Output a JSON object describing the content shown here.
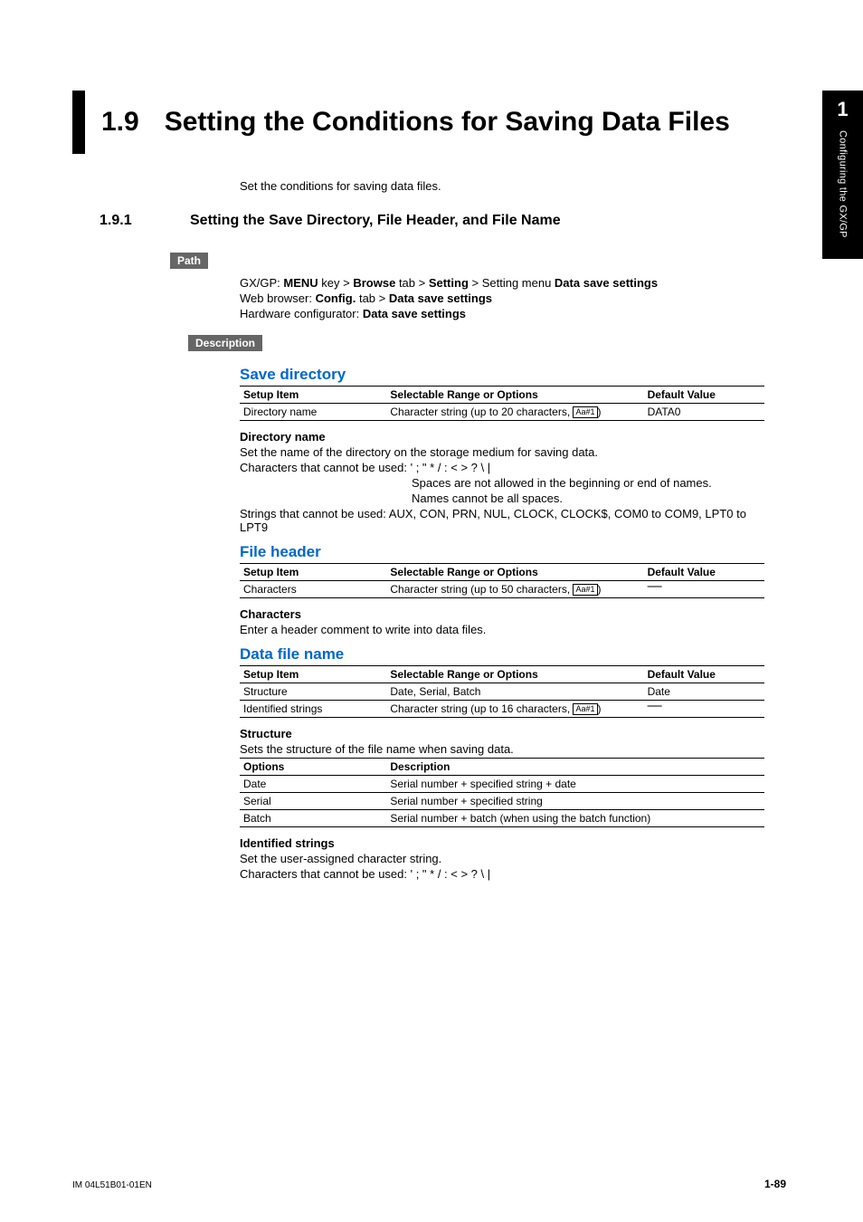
{
  "tab": {
    "num": "1",
    "text": "Configuring the GX/GP"
  },
  "title": {
    "num": "1.9",
    "text": "Setting the Conditions for Saving Data Files"
  },
  "intro": "Set the conditions for saving data files.",
  "sub": {
    "num": "1.9.1",
    "text": "Setting the Save Directory, File Header, and File Name"
  },
  "tags": {
    "path": "Path",
    "description": "Description"
  },
  "path": {
    "l1a": "GX/GP: ",
    "l1b": "MENU",
    "l1c": " key > ",
    "l1d": "Browse",
    "l1e": " tab > ",
    "l1f": "Setting",
    "l1g": " > Setting menu ",
    "l1h": "Data save settings",
    "l2a": "Web browser: ",
    "l2b": "Config.",
    "l2c": " tab > ",
    "l2d": "Data save settings",
    "l3a": "Hardware configurator: ",
    "l3b": "Data save settings"
  },
  "headers": {
    "setup": "Setup Item",
    "range": "Selectable Range or Options",
    "default": "Default Value",
    "options": "Options",
    "desc": "Description"
  },
  "saveDir": {
    "title": "Save directory",
    "row": {
      "item": "Directory name",
      "range_pre": "Character string (up to 20 characters, ",
      "range_icon": "Aa#1",
      "range_post": ")",
      "def": "DATA0"
    },
    "sub": "Directory name",
    "p1": "Set the name of the directory on the storage medium for saving data.",
    "p2": "Characters that cannot be used: ' ; \" * / : < > ? \\ |",
    "p3": "Spaces are not allowed in the beginning or end of names.",
    "p4": "Names cannot be all spaces.",
    "p5": "Strings that cannot be used: AUX, CON, PRN, NUL, CLOCK, CLOCK$, COM0 to COM9, LPT0 to LPT9"
  },
  "fileHeader": {
    "title": "File header",
    "row": {
      "item": "Characters",
      "range_pre": "Character string (up to 50 characters, ",
      "range_icon": "Aa#1",
      "range_post": ")",
      "def": "―"
    },
    "sub": "Characters",
    "p1": "Enter a header comment to write into data files."
  },
  "dataFile": {
    "title": "Data file name",
    "r1": {
      "item": "Structure",
      "range": "Date, Serial, Batch",
      "def": "Date"
    },
    "r2": {
      "item": "Identified strings",
      "range_pre": "Character string (up to 16 characters, ",
      "range_icon": "Aa#1",
      "range_post": ")",
      "def": "―"
    },
    "structSub": "Structure",
    "structIntro": "Sets the structure of the file name when saving data.",
    "opt1": {
      "o": "Date",
      "d": "Serial number + specified string + date"
    },
    "opt2": {
      "o": "Serial",
      "d": "Serial number + specified string"
    },
    "opt3": {
      "o": "Batch",
      "d": "Serial number + batch (when using the batch function)"
    },
    "idSub": "Identified strings",
    "idP1": "Set the user-assigned character string.",
    "idP2": "Characters that cannot be used: ' ; \" * / : < > ? \\ |"
  },
  "footer": {
    "left": "IM 04L51B01-01EN",
    "right": "1-89"
  }
}
